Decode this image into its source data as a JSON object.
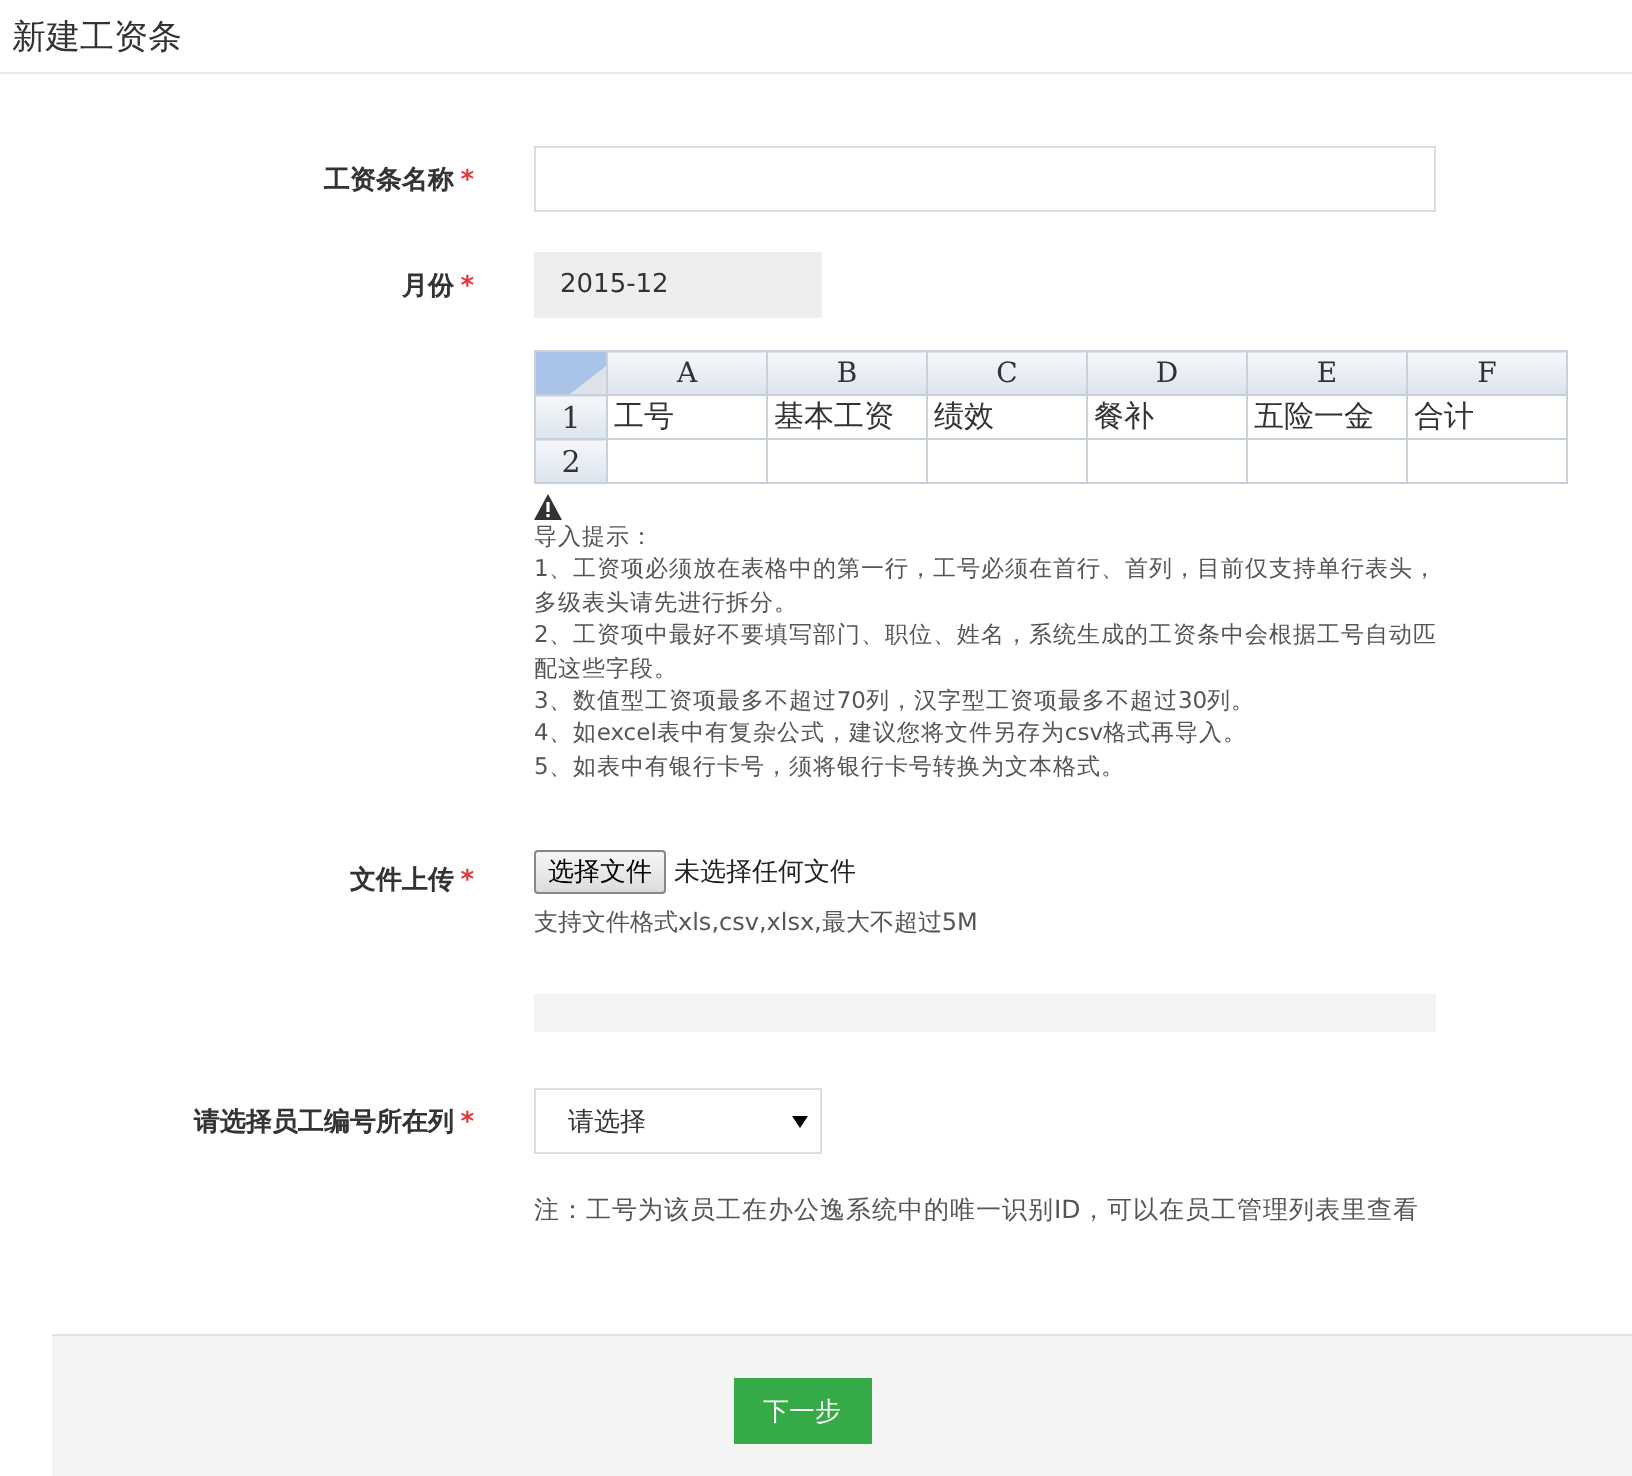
{
  "page": {
    "title": "新建工资条"
  },
  "name_field": {
    "label": "工资条名称",
    "required_mark": "*"
  },
  "month_field": {
    "label": "月份",
    "required_mark": "*",
    "value": "2015-12",
    "disabled": true
  },
  "template_example": {
    "columns": [
      "A",
      "B",
      "C",
      "D",
      "E",
      "F"
    ],
    "rows": [
      {
        "number": "1",
        "cells": [
          "工号",
          "基本工资",
          "绩效",
          "餐补",
          "五险一金",
          "合计"
        ]
      },
      {
        "number": "2"
      }
    ]
  },
  "import_tips": {
    "title": "导入提示：",
    "lines": [
      "1、工资项必须放在表格中的第一行，工号必须在首行、首列，目前仅支持单行表头，多级表头请先进行拆分。",
      "2、工资项中最好不要填写部门、职位、姓名，系统生成的工资条中会根据工号自动匹配这些字段。",
      "3、数值型工资项最多不超过70列，汉字型工资项最多不超过30列。",
      "4、如excel表中有复杂公式，建议您将文件另存为csv格式再导入。",
      "5、如表中有银行卡号，须将银行卡号转换为文本格式。"
    ]
  },
  "file_upload": {
    "label": "文件上传",
    "required_mark": "*",
    "button": "选择文件",
    "status": "未选择任何文件",
    "hint": "支持文件格式xls,csv,xlsx,最大不超过5M",
    "progress": {
      "level": 0
    }
  },
  "employee_column": {
    "label": "请选择员工编号所在列",
    "required_mark": "*",
    "value": "请选择",
    "note": "注：工号为该员工在办公逸系统中的唯一识别ID，可以在员工管理列表里查看"
  },
  "footer": {
    "next_button": "下一步"
  }
}
